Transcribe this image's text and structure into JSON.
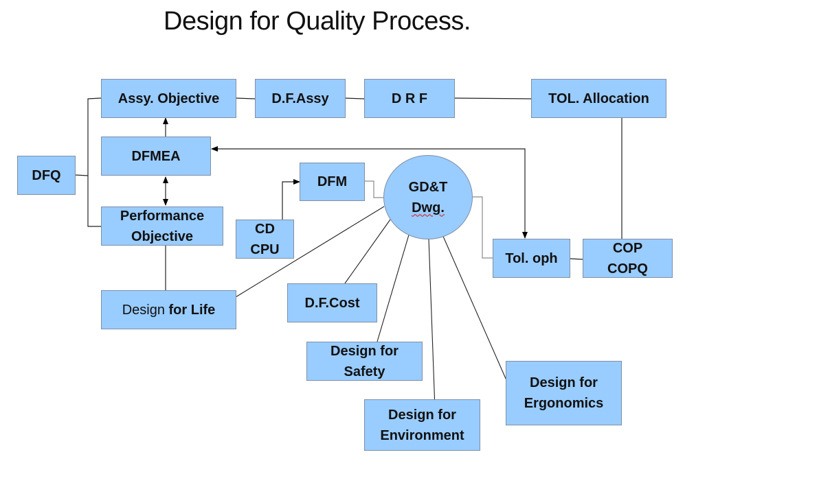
{
  "title": "Design for Quality Process.",
  "colors": {
    "box_fill": "#99ccff",
    "box_border": "#7f8fa6",
    "line": "#000000"
  },
  "nodes": {
    "dfq": {
      "lines": [
        "DFQ"
      ]
    },
    "assy_objective": {
      "lines": [
        "Assy. Objective"
      ]
    },
    "df_assy": {
      "lines": [
        "D.F.Assy"
      ]
    },
    "drf": {
      "lines": [
        "D R F"
      ]
    },
    "tol_allocation": {
      "lines": [
        "TOL. Allocation"
      ]
    },
    "dfmea": {
      "lines": [
        "DFMEA"
      ]
    },
    "performance_objective": {
      "lines": [
        "Performance",
        "Objective"
      ]
    },
    "dfm": {
      "lines": [
        "DFM"
      ]
    },
    "cd_cpu": {
      "lines": [
        "CD",
        "CPU"
      ]
    },
    "gdt_dwg": {
      "lines": [
        "GD&T",
        "Dwg."
      ]
    },
    "tol_oph": {
      "lines": [
        "Tol. oph"
      ]
    },
    "cop_copq": {
      "lines": [
        "COP",
        "COPQ"
      ]
    },
    "design_for_life": {
      "prefix": "Design ",
      "bold": "for Life"
    },
    "df_cost": {
      "lines": [
        "D.F.Cost"
      ]
    },
    "design_for_safety": {
      "lines": [
        "Design for",
        "Safety"
      ]
    },
    "design_for_environment": {
      "lines": [
        "Design for",
        "Environment"
      ]
    },
    "design_for_ergonomics": {
      "lines": [
        "Design for",
        "Ergonomics"
      ]
    }
  }
}
